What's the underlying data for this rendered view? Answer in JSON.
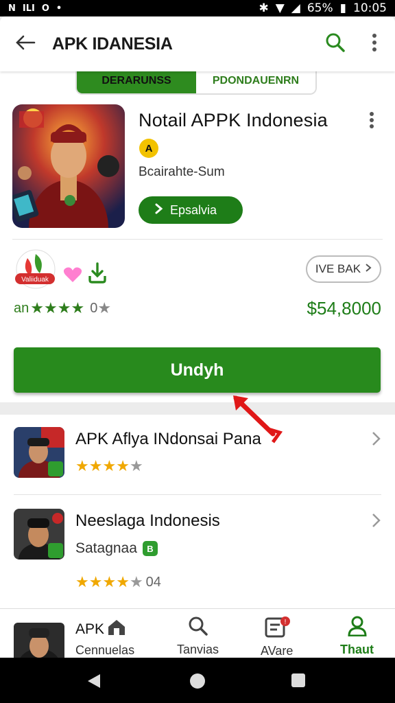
{
  "status_bar": {
    "left_icons": [
      "N",
      "ILI",
      "O"
    ],
    "battery": "65%",
    "time": "10:05"
  },
  "app_bar": {
    "title": "APK IDANESIA",
    "back_icon": "arrow-left-icon",
    "search_icon": "search-icon",
    "more_icon": "more-vert-icon"
  },
  "tabs": [
    {
      "label": "DERARUNSS",
      "active": true
    },
    {
      "label": "PDONDAUENRN",
      "active": false
    }
  ],
  "app_detail": {
    "title": "Notail APPK Indonesia",
    "rating_badge": "A",
    "developer": "Bcairahte-Sum",
    "chip_button": "Epsalvia",
    "badge_logo_text": "Valiiduak",
    "more_back_label": "IVE BAK",
    "stars_prefix": "an",
    "stars_rating": 4,
    "stars_count": "0",
    "price": "$54,8000",
    "main_button": "Undyh"
  },
  "list": [
    {
      "title": "APK Aflya INdonsai Pana",
      "rating": 4,
      "subtitle": ""
    },
    {
      "title": "Neeslaga Indonesis",
      "rating": 4,
      "subtitle": "Satagnaa",
      "count": "04"
    }
  ],
  "bottom_nav": [
    {
      "label": "Cennuelas",
      "head": "APK",
      "icon": "store-icon"
    },
    {
      "label": "Tanvias",
      "icon": "search-icon"
    },
    {
      "label": "AVare",
      "icon": "notification-icon"
    },
    {
      "label": "Thaut",
      "icon": "account-icon",
      "active": true
    }
  ],
  "colors": {
    "primary_green": "#288a1d",
    "star_yellow": "#f0a800",
    "price_green": "#1e7d18"
  }
}
